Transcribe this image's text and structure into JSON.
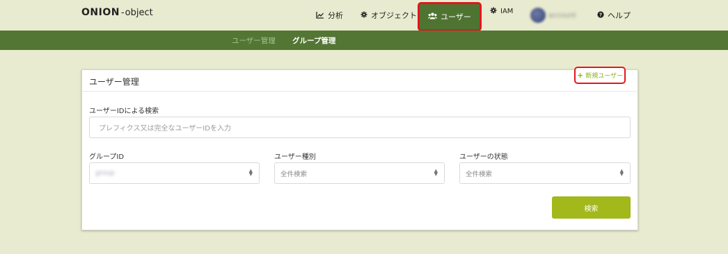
{
  "header": {
    "logo_brand": "ONION",
    "logo_dash": "-",
    "logo_sub": "object",
    "nav": {
      "analysis": {
        "label": "分析",
        "icon": "chart-line-icon",
        "glyph": "📈"
      },
      "object": {
        "label": "オブジェクト",
        "icon": "gear-icon",
        "glyph": "✱"
      },
      "user": {
        "label": "ユーザー",
        "icon": "users-icon",
        "glyph": "👥"
      },
      "iam": {
        "label": "IAM",
        "icon": "gear-icon",
        "glyph": "✱"
      },
      "account": {
        "name": "account"
      },
      "help": {
        "label": "ヘルプ",
        "icon": "question-circle-icon",
        "glyph": "❓"
      }
    }
  },
  "subnav": {
    "tabs": [
      {
        "label": "ユーザー管理",
        "active": false
      },
      {
        "label": "グループ管理",
        "active": true
      }
    ]
  },
  "panel": {
    "title": "ユーザー管理",
    "new_user_label": "新規ユーザー",
    "search_by_id_label": "ユーザーIDによる検索",
    "search_by_id_placeholder": "プレフィクス又は完全なユーザーIDを入力",
    "group_id_label": "グループID",
    "group_id_value": "group",
    "user_type_label": "ユーザー種別",
    "user_type_value": "全件検索",
    "user_status_label": "ユーザーの状態",
    "user_status_value": "全件検索",
    "search_button": "検索"
  },
  "colors": {
    "background": "#e8ebcf",
    "nav_active": "#4f7432",
    "subbar": "#537634",
    "accent": "#a2b81b",
    "highlight": "#e3161c"
  }
}
